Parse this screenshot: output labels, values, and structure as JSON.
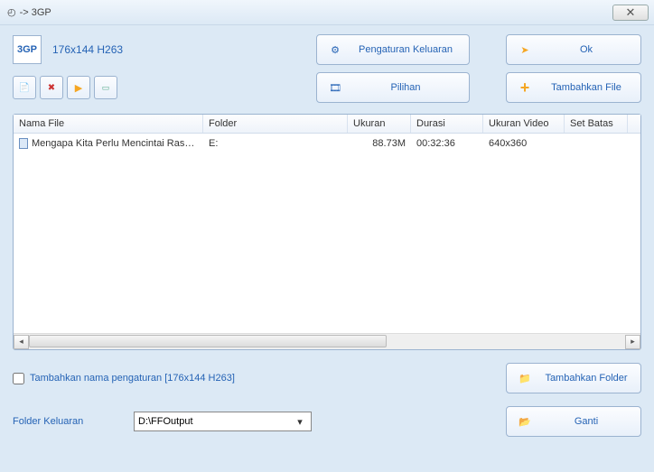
{
  "window": {
    "title": "-> 3GP"
  },
  "format": {
    "icon_label": "3GP",
    "resolution": "176x144 H263"
  },
  "buttons": {
    "output_settings": "Pengaturan Keluaran",
    "ok": "Ok",
    "options": "Pilihan",
    "add_file": "Tambahkan File",
    "add_folder": "Tambahkan Folder",
    "change": "Ganti"
  },
  "table": {
    "headers": {
      "name": "Nama File",
      "folder": "Folder",
      "size": "Ukuran",
      "duration": "Durasi",
      "video_size": "Ukuran Video",
      "set_limit": "Set Batas"
    },
    "rows": [
      {
        "name": "Mengapa Kita Perlu Mencintai Rasul...",
        "folder": "E:",
        "size": "88.73M",
        "duration": "00:32:36",
        "video_size": "640x360",
        "set_limit": ""
      }
    ]
  },
  "checkbox": {
    "label": "Tambahkan nama pengaturan [176x144 H263]"
  },
  "output": {
    "label": "Folder Keluaran",
    "path": "D:\\FFOutput"
  }
}
